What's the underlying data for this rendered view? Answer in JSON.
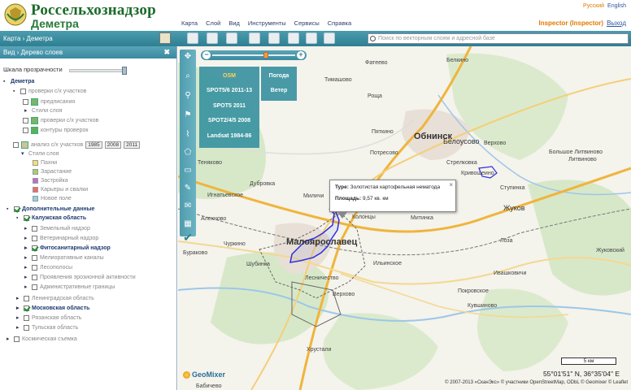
{
  "header": {
    "brand": "Россельхознадзор",
    "subbrand": "Деметра",
    "menu": [
      "Карта",
      "Слой",
      "Вид",
      "Инструменты",
      "Сервисы",
      "Справка"
    ],
    "lang": {
      "ru": "Русский",
      "en": "English"
    },
    "user": {
      "name": "Inspector (Inspector)",
      "logout": "Выход"
    }
  },
  "toolbar": {
    "crumb_root": "Карта",
    "crumb_sep": "›",
    "crumb_item": "Деметра",
    "search_placeholder": "Поиск по векторным слоям и адресной базе"
  },
  "sidebar": {
    "head_view": "Вид",
    "head_sep": "›",
    "head_title": "Дерево слоев",
    "close": "✖",
    "opacity_label": "Шкала прозрачности",
    "tree": {
      "root": "Деметра",
      "checks_group": "проверки с/х участков",
      "podlozhka": "предписания",
      "styles": "Стили слоя",
      "checks_layer": "проверки с/х участков",
      "contours": "контуры проверок",
      "analysis": "анализ с/х участков",
      "years": [
        "1985",
        "2008",
        "2011"
      ],
      "styles2": "Стили слоя",
      "legend": [
        "Пахни",
        "Зарастание",
        "Застройка",
        "Карьеры и свалки",
        "Новое поле"
      ],
      "legend_colors": [
        "#f3e36b",
        "#9fd36a",
        "#c06ad8",
        "#ef6a6a",
        "#8fd3e8"
      ],
      "additional": "Дополнительные данные",
      "kaluga": "Калужская область",
      "kaluga_items": [
        "Земельный надзор",
        "Ветеринарный надзор",
        "Фитосанитарный надзор",
        "Мелиоративные каналы",
        "Лесополосы",
        "Проявления эрозионной активности",
        "Административные границы"
      ],
      "leningrad": "Ленинградская область",
      "moscow": "Московская область",
      "ryazan": "Рязанская область",
      "tula": "Тульская область",
      "space": "Космическая съемка"
    }
  },
  "map": {
    "basemaps": [
      "OSM",
      "SPOT5/6 2011-13",
      "SPOT5 2011",
      "SPOT2/4/5 2008",
      "Landsat 1984-86"
    ],
    "overlays": [
      "Погода",
      "Ветер"
    ],
    "popup": {
      "type_key": "Type:",
      "type_val": "Золотистая картофельная нематода",
      "area_key": "Площадь:",
      "area_val": "9,57 кв. км",
      "close": "×"
    },
    "scale": "5 км",
    "coords": "55°01'51\" N, 36°35'04\" E",
    "attribution": "© 2007-2013 «СканЭкс» © участники OpenStreetMap, ODbL © Geomixer © Leaflet",
    "geomixer": "GeoMixer",
    "places": [
      {
        "t": "Обнинск",
        "c": "big"
      },
      {
        "t": "Малоярославец",
        "c": "big"
      },
      {
        "t": "Жуков",
        "c": "med"
      },
      {
        "t": "Белоусово",
        "c": "med"
      },
      {
        "t": "Белкино",
        "c": ""
      },
      {
        "t": "Тимашово",
        "c": ""
      },
      {
        "t": "Фатеево",
        "c": ""
      },
      {
        "t": "Роща",
        "c": ""
      },
      {
        "t": "Пяткино",
        "c": ""
      },
      {
        "t": "Верхово",
        "c": ""
      },
      {
        "t": "Большое Литвиново",
        "c": ""
      },
      {
        "t": "Литвиново",
        "c": ""
      },
      {
        "t": "Кривошеино",
        "c": ""
      },
      {
        "t": "Стрелковка",
        "c": ""
      },
      {
        "t": "Ступинка",
        "c": ""
      },
      {
        "t": "Теняково",
        "c": ""
      },
      {
        "t": "Дубровка",
        "c": ""
      },
      {
        "t": "Игнатьевское",
        "c": ""
      },
      {
        "t": "Алехново",
        "c": ""
      },
      {
        "t": "Чуркино",
        "c": ""
      },
      {
        "t": "Бураково",
        "c": ""
      },
      {
        "t": "Шубинка",
        "c": ""
      },
      {
        "t": "Миличи",
        "c": ""
      },
      {
        "t": "Колонцы",
        "c": ""
      },
      {
        "t": "Митинка",
        "c": ""
      },
      {
        "t": "Потресово",
        "c": ""
      },
      {
        "t": "Ильинское",
        "c": ""
      },
      {
        "t": "Лесничество",
        "c": ""
      },
      {
        "t": "Верхово",
        "c": ""
      },
      {
        "t": "Лоза",
        "c": ""
      },
      {
        "t": "Покровское",
        "c": ""
      },
      {
        "t": "Кувшиново",
        "c": ""
      },
      {
        "t": "Ивашковичи",
        "c": ""
      },
      {
        "t": "Хрустали",
        "c": ""
      },
      {
        "t": "Бабичево",
        "c": ""
      },
      {
        "t": "Жуковский",
        "c": ""
      }
    ]
  }
}
